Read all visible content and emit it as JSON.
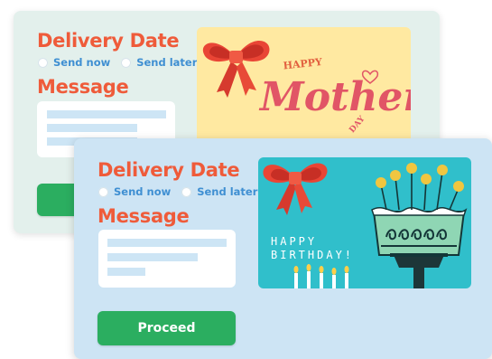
{
  "back_card": {
    "delivery_heading": "Delivery Date",
    "send_now": "Send now",
    "send_later": "Send later",
    "message_heading": "Message",
    "gift_card": {
      "text_top": "HAPPY",
      "text_main": "Mothers",
      "text_bottom": "DAY"
    }
  },
  "front_card": {
    "delivery_heading": "Delivery Date",
    "send_now": "Send now",
    "send_later": "Send later",
    "message_heading": "Message",
    "proceed_label": "Proceed",
    "gift_card": {
      "line1": "HAPPY",
      "line2": "BIRTHDAY!"
    }
  },
  "colors": {
    "heading": "#ef5b3a",
    "link": "#3f8fd2",
    "button": "#2bae60",
    "back_card_bg": "#e3f0ec",
    "front_card_bg": "#cde4f4"
  }
}
